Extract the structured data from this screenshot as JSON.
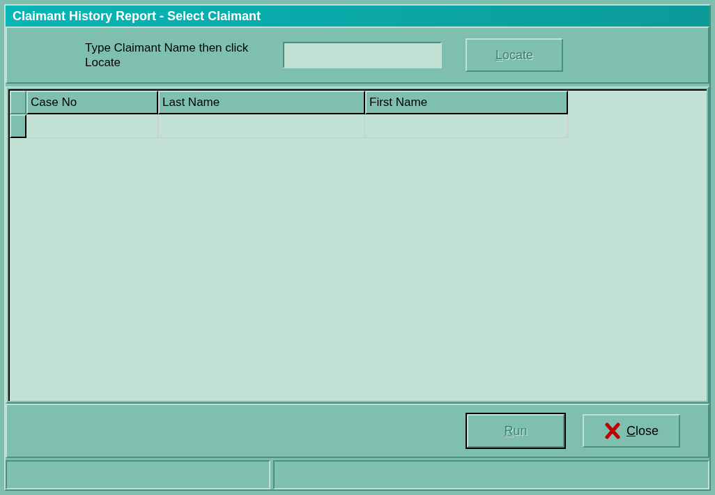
{
  "window": {
    "title": "Claimant History Report - Select Claimant"
  },
  "search": {
    "label": "Type Claimant Name then click Locate"
  },
  "locate_button": {
    "label": "Locate",
    "disabled": true
  },
  "table": {
    "columns": [
      "Case No",
      "Last Name",
      "First Name"
    ]
  },
  "buttons": [
    {
      "kind": "run",
      "label": "Run",
      "disabled": true
    },
    {
      "kind": "close",
      "label": "Close",
      "disabled": false
    }
  ]
}
